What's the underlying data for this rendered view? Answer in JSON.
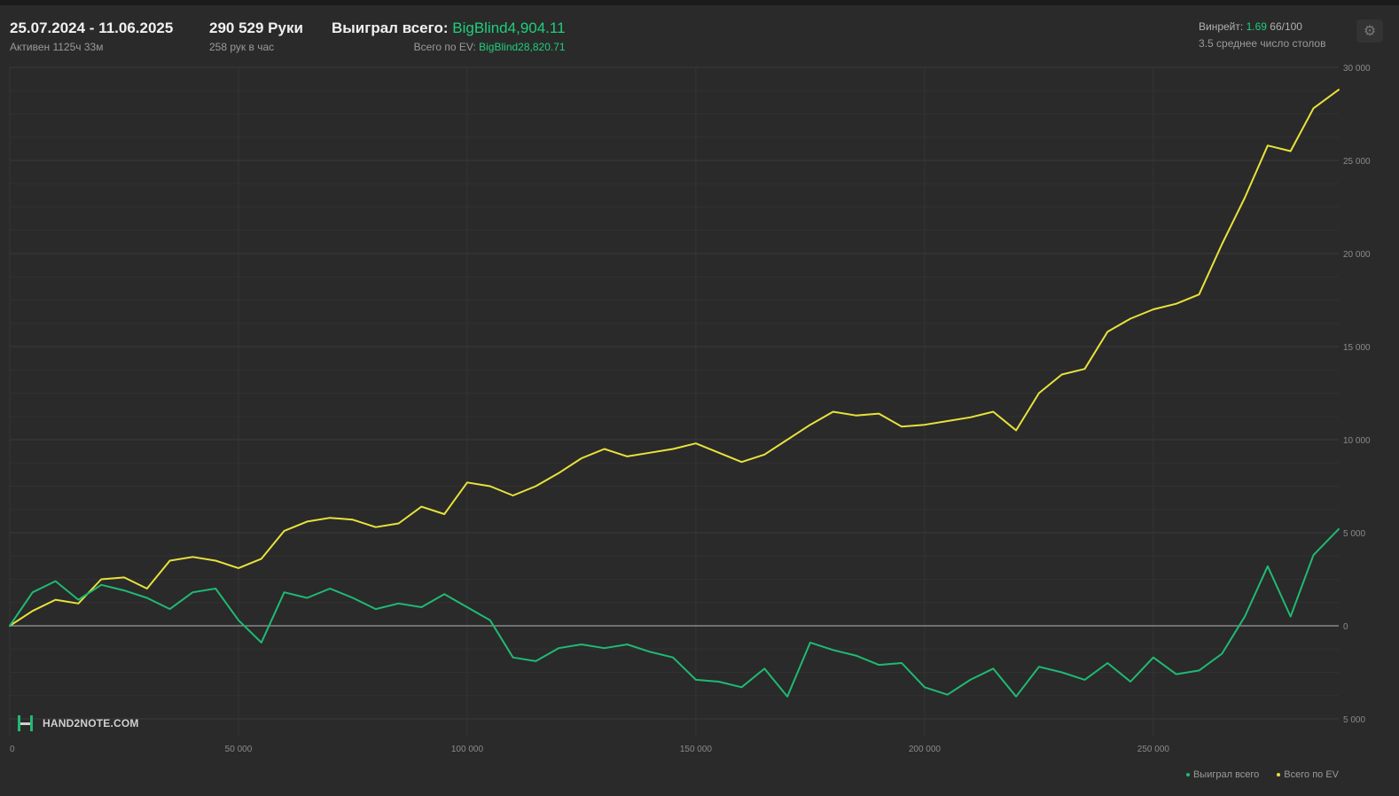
{
  "header": {
    "date_range": "25.07.2024 - 11.06.2025",
    "active": "Активен 1125ч 33м",
    "hands": "290 529 Руки",
    "hands_per_hour": "258 рук в час",
    "won_label": "Выиграл всего:",
    "won_value": "BigBlind4,904.11",
    "ev_label": "Всего по EV:",
    "ev_value": "BigBlind28,820.71",
    "winrate_label": "Винрейт:",
    "winrate_value": "1.69",
    "winrate_unit": "66/100",
    "avg_tables": "3.5 среднее число столов"
  },
  "logo": {
    "text": "HAND2NOTE.COM"
  },
  "colors": {
    "background": "#2a2a2a",
    "won": "#1fba73",
    "ev": "#e8e23c",
    "accent_text": "#1fcf7a"
  },
  "icons": {
    "settings": "gear-icon",
    "logo": "hand2note-logo-icon"
  },
  "chart_data": {
    "type": "line",
    "xlim": [
      0,
      290529
    ],
    "ylim": [
      -5000,
      30000
    ],
    "x_ticks": [
      0,
      50000,
      100000,
      150000,
      200000,
      250000
    ],
    "x_tick_labels": [
      "0",
      "50 000",
      "100 000",
      "150 000",
      "200 000",
      "250 000"
    ],
    "y_ticks": [
      30000,
      25000,
      20000,
      15000,
      10000,
      5000,
      0,
      -5000
    ],
    "y_tick_labels": [
      "30 000",
      "25 000",
      "20 000",
      "15 000",
      "10 000",
      "5 000",
      "0",
      "5 000"
    ],
    "grid": true,
    "legend_position": "bottom-right",
    "x": [
      0,
      5000,
      10000,
      15000,
      20000,
      25000,
      30000,
      35000,
      40000,
      45000,
      50000,
      55000,
      60000,
      65000,
      70000,
      75000,
      80000,
      85000,
      90000,
      95000,
      100000,
      105000,
      110000,
      115000,
      120000,
      125000,
      130000,
      135000,
      140000,
      145000,
      150000,
      155000,
      160000,
      165000,
      170000,
      175000,
      180000,
      185000,
      190000,
      195000,
      200000,
      205000,
      210000,
      215000,
      220000,
      225000,
      230000,
      235000,
      240000,
      245000,
      250000,
      255000,
      260000,
      265000,
      270000,
      275000,
      280000,
      285000,
      290529
    ],
    "series": [
      {
        "name": "Выиграл всего",
        "color": "#1fba73",
        "values": [
          0,
          1800,
          2400,
          1400,
          2200,
          1900,
          1500,
          900,
          1800,
          2000,
          300,
          -900,
          1800,
          1500,
          2000,
          1500,
          900,
          1200,
          1000,
          1700,
          1000,
          300,
          -1700,
          -1900,
          -1200,
          -1000,
          -1200,
          -1000,
          -1400,
          -1700,
          -2900,
          -3000,
          -3300,
          -2300,
          -3800,
          -900,
          -1300,
          -1600,
          -2100,
          -2000,
          -3300,
          -3700,
          -2900,
          -2300,
          -3800,
          -2200,
          -2500,
          -2900,
          -2000,
          -3000,
          -1700,
          -2600,
          -2400,
          -1500,
          500,
          3200,
          500,
          3800,
          5200
        ]
      },
      {
        "name": "Всего по EV",
        "color": "#e8e23c",
        "values": [
          0,
          800,
          1400,
          1200,
          2500,
          2600,
          2000,
          3500,
          3700,
          3500,
          3100,
          3600,
          5100,
          5600,
          5800,
          5700,
          5300,
          5500,
          6400,
          6000,
          7700,
          7500,
          7000,
          7500,
          8200,
          9000,
          9500,
          9100,
          9300,
          9500,
          9800,
          9300,
          8800,
          9200,
          10000,
          10800,
          11500,
          11300,
          11400,
          10700,
          10800,
          11000,
          11200,
          11500,
          10500,
          12500,
          13500,
          13800,
          15800,
          16500,
          17000,
          17300,
          17800,
          20500,
          23000,
          25800,
          25500,
          27800,
          28800
        ]
      }
    ]
  }
}
